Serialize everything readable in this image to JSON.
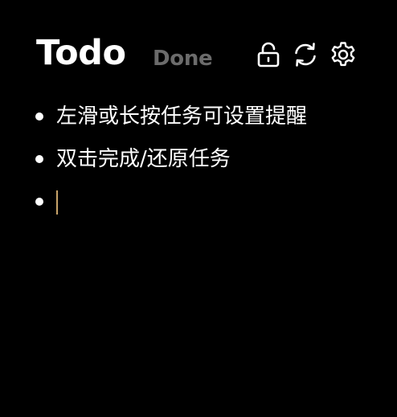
{
  "header": {
    "tabs": {
      "todo_label": "Todo",
      "done_label": "Done"
    },
    "icons": [
      "lock-icon",
      "refresh-icon",
      "gear-icon"
    ]
  },
  "tasks": [
    {
      "text": "左滑或长按任务可设置提醒"
    },
    {
      "text": "双击完成/还原任务"
    }
  ],
  "new_task": {
    "value": ""
  },
  "colors": {
    "background": "#000000",
    "text": "#ffffff",
    "inactive_tab": "#6b6b6b",
    "caret": "#c9a46a"
  }
}
